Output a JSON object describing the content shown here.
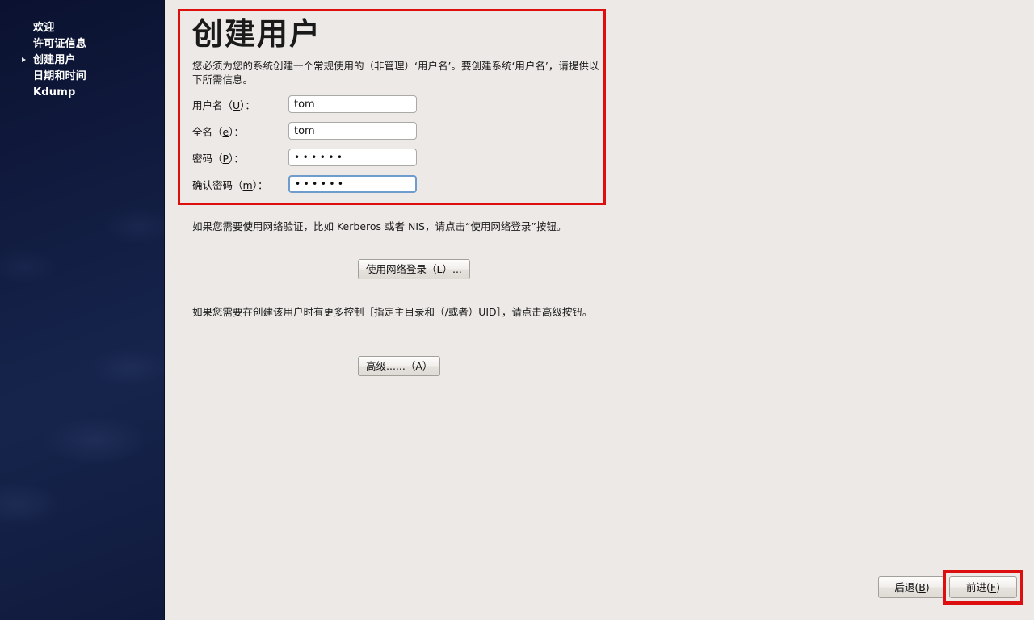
{
  "sidebar": {
    "items": [
      {
        "label": "欢迎",
        "current": false
      },
      {
        "label": "许可证信息",
        "current": false
      },
      {
        "label": "创建用户",
        "current": true
      },
      {
        "label": "日期和时间",
        "current": false
      },
      {
        "label": "Kdump",
        "current": false
      }
    ]
  },
  "main": {
    "title": "创建用户",
    "intro": "您必须为您的系统创建一个常规使用的（非管理）‘用户名’。要创建系统‘用户名’，请提供以下所需信息。",
    "fields": [
      {
        "label_prefix": "用户名（",
        "accel": "U",
        "label_suffix": "）：",
        "value": "tom",
        "type": "text",
        "focused": false
      },
      {
        "label_prefix": "全名（",
        "accel": "e",
        "label_suffix": "）：",
        "value": "tom",
        "type": "text",
        "focused": false
      },
      {
        "label_prefix": "密码（",
        "accel": "P",
        "label_suffix": "）：",
        "value": "••••••",
        "type": "password",
        "focused": false
      },
      {
        "label_prefix": "确认密码（",
        "accel": "m",
        "label_suffix": "）：",
        "value": "••••••",
        "type": "password",
        "focused": true
      }
    ],
    "network_text": "如果您需要使用网络验证，比如 Kerberos 或者 NIS，请点击“使用网络登录”按钮。",
    "network_button": {
      "prefix": "使用网络登录（",
      "accel": "L",
      "suffix": "）..."
    },
    "advanced_text": "如果您需要在创建该用户时有更多控制［指定主目录和（/或者）UID］，请点击高级按钮。",
    "advanced_button": {
      "prefix": "高级......（",
      "accel": "A",
      "suffix": "）"
    }
  },
  "footer": {
    "back_button": {
      "prefix": "后退(",
      "accel": "B",
      "suffix": ")"
    },
    "forward_button": {
      "prefix": "前进(",
      "accel": "F",
      "suffix": ")"
    }
  },
  "annotations": {
    "highlight_color": "#dd0e0e"
  }
}
